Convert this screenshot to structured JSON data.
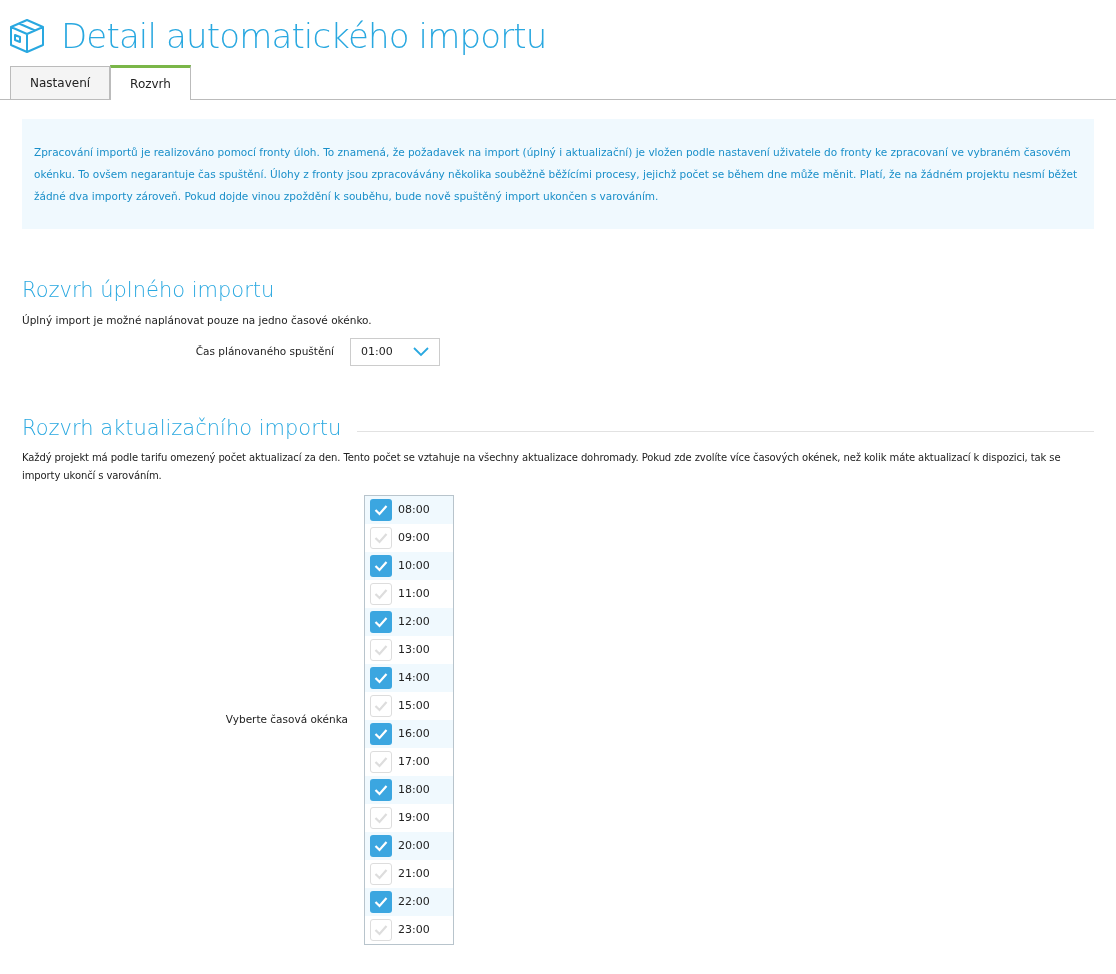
{
  "page_title": "Detail automatického importu",
  "tabs": [
    {
      "label": "Nastavení",
      "selected": false
    },
    {
      "label": "Rozvrh",
      "selected": true
    }
  ],
  "info_text": "Zpracování importů je realizováno pomocí fronty úloh. To znamená, že požadavek na import (úplný i aktualizační) je vložen podle nastavení uživatele do fronty ke zpracovaní ve vybraném časovém okénku. To ovšem negarantuje čas spuštění. Úlohy z fronty jsou zpracovávány několika souběžně běžícími procesy, jejichž počet se během dne může měnit. Platí, že na žádném projektu nesmí běžet žádné dva importy zároveň. Pokud dojde vinou zpoždění k souběhu, bude nově spuštěný import ukončen s varováním.",
  "full_import": {
    "heading": "Rozvrh úplného importu",
    "description": "Úplný import je možné naplánovat pouze na jedno časové okénko.",
    "label": "Čas plánovaného spuštění",
    "value": "01:00"
  },
  "update_import": {
    "heading": "Rozvrh aktualizačního importu",
    "description": "Každý projekt má podle tarifu omezený počet aktualizací za den. Tento počet se vztahuje na všechny aktualizace dohromady. Pokud zde zvolíte více časových okének, než kolik máte aktualizací k dispozici, tak se importy ukončí s varováním.",
    "label": "Vyberte časová okénka",
    "slots": [
      {
        "time": "08:00",
        "checked": true
      },
      {
        "time": "09:00",
        "checked": false
      },
      {
        "time": "10:00",
        "checked": true
      },
      {
        "time": "11:00",
        "checked": false
      },
      {
        "time": "12:00",
        "checked": true
      },
      {
        "time": "13:00",
        "checked": false
      },
      {
        "time": "14:00",
        "checked": true
      },
      {
        "time": "15:00",
        "checked": false
      },
      {
        "time": "16:00",
        "checked": true
      },
      {
        "time": "17:00",
        "checked": false
      },
      {
        "time": "18:00",
        "checked": true
      },
      {
        "time": "19:00",
        "checked": false
      },
      {
        "time": "20:00",
        "checked": true
      },
      {
        "time": "21:00",
        "checked": false
      },
      {
        "time": "22:00",
        "checked": true
      },
      {
        "time": "23:00",
        "checked": false
      }
    ]
  }
}
